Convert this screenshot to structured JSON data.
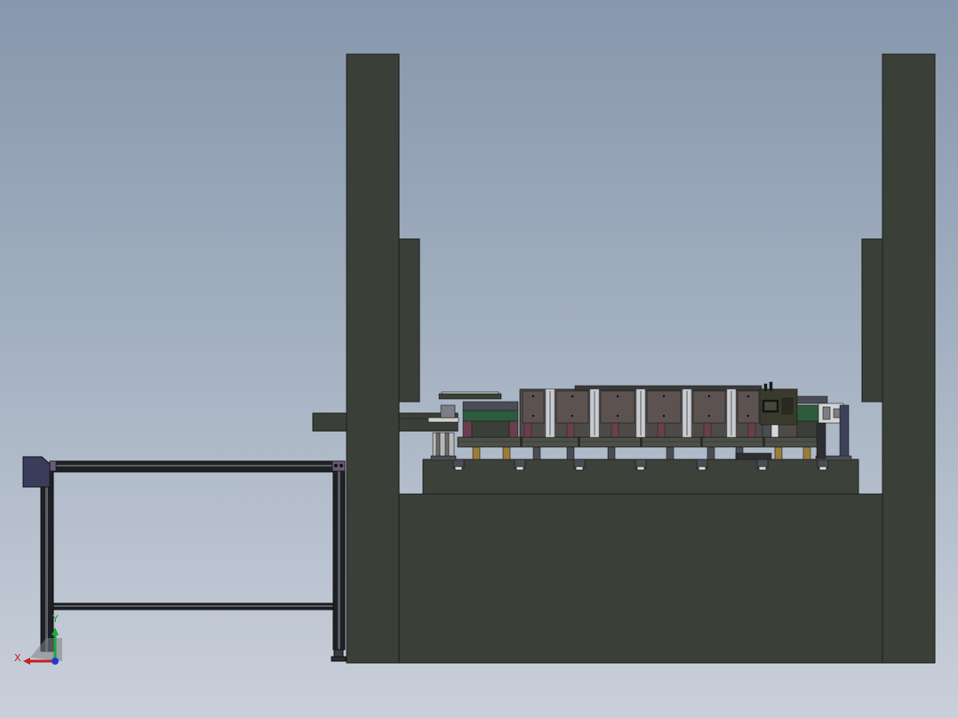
{
  "viewport": {
    "background_top": "#8797ad",
    "background_bottom": "#cad0da"
  },
  "model": {
    "frame_color": "#3a3f38",
    "edge_color": "#1c1f1c",
    "fixture_top_color": "#4e4a47",
    "gold_color": "#9a7d3a",
    "green_color": "#2e5b3e",
    "profile_color": "#1e2024",
    "purple_color": "#6a5a78"
  },
  "triad": {
    "x_label": "X",
    "y_label": "Y",
    "x_color": "#cc1f1f",
    "y_color": "#1fa83a",
    "z_color": "#1f3acc"
  }
}
